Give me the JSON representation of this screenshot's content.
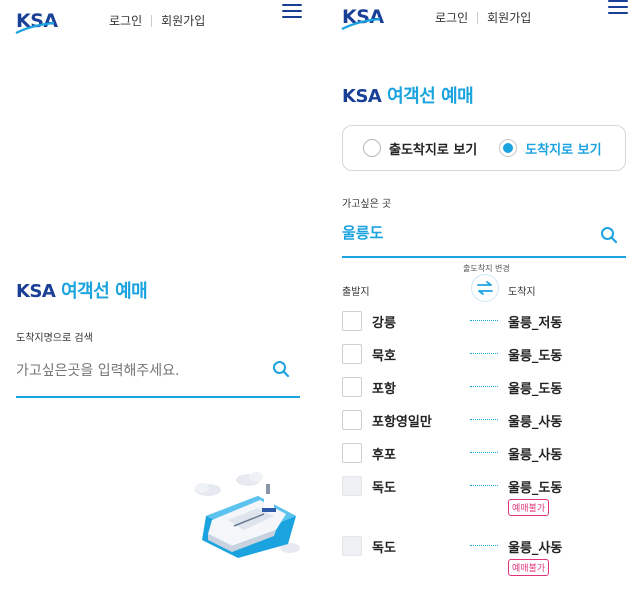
{
  "header": {
    "logo_text": "KSA",
    "login": "로그인",
    "signup": "회원가입"
  },
  "left": {
    "title_brand": "KSA",
    "title_sub": "여객선 예매",
    "search_label": "도착지명으로 검색",
    "search_placeholder": "가고싶은곳을 입력해주세요."
  },
  "right": {
    "title_brand": "KSA",
    "title_sub": "여객선 예매",
    "view_options": [
      "출도착지로 보기",
      "도착지로 보기"
    ],
    "selected_view": "도착지로 보기",
    "destination_label": "가고싶은 곳",
    "destination_value": "울릉도",
    "swap_label": "출도착지 변경",
    "col_from": "출발지",
    "col_to": "도착지",
    "routes": [
      {
        "from": "강릉",
        "to": "울릉_저동",
        "available": true,
        "badge": ""
      },
      {
        "from": "묵호",
        "to": "울릉_도동",
        "available": true,
        "badge": ""
      },
      {
        "from": "포항",
        "to": "울릉_도동",
        "available": true,
        "badge": ""
      },
      {
        "from": "포항영일만",
        "to": "울릉_사동",
        "available": true,
        "badge": ""
      },
      {
        "from": "후포",
        "to": "울릉_사동",
        "available": true,
        "badge": ""
      },
      {
        "from": "독도",
        "to": "울릉_도동",
        "available": false,
        "badge": "예매불가"
      },
      {
        "from": "독도",
        "to": "울릉_사동",
        "available": false,
        "badge": "예매불가"
      }
    ]
  },
  "colors": {
    "brand_navy": "#1a3f96",
    "accent_blue": "#1ba3e0",
    "badge_pink": "#e0357a"
  },
  "icons": [
    "menu-icon",
    "search-icon",
    "swap-arrows-icon",
    "ship-illustration"
  ]
}
